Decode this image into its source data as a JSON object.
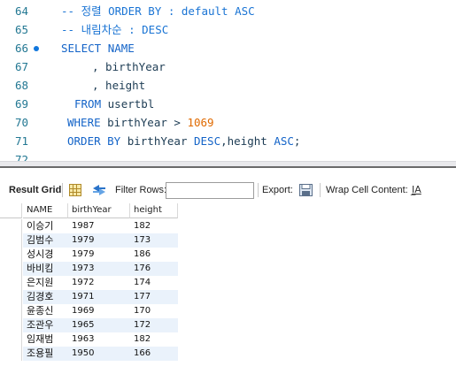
{
  "editor": {
    "lines": [
      {
        "no": "64",
        "indent": 0,
        "tokens": [
          {
            "t": "-- 정렬 ORDER BY : default ASC",
            "c": "comment"
          }
        ]
      },
      {
        "no": "65",
        "indent": 0,
        "tokens": [
          {
            "t": "-- 내림차순 : DESC",
            "c": "comment"
          }
        ]
      },
      {
        "no": "66",
        "indent": 0,
        "breakpoint": true,
        "tokens": [
          {
            "t": "SELECT ",
            "c": "kw"
          },
          {
            "t": "NAME",
            "c": "kw"
          }
        ]
      },
      {
        "no": "67",
        "indent": 1,
        "tokens": [
          {
            "t": ", birthYear",
            "c": "id"
          }
        ]
      },
      {
        "no": "68",
        "indent": 1,
        "tokens": [
          {
            "t": ", height",
            "c": "id"
          }
        ]
      },
      {
        "no": "69",
        "indent": 2,
        "tokens": [
          {
            "t": "FROM ",
            "c": "kw"
          },
          {
            "t": "usertbl",
            "c": "id"
          }
        ]
      },
      {
        "no": "70",
        "indent": 3,
        "tokens": [
          {
            "t": "WHERE ",
            "c": "kw"
          },
          {
            "t": "birthYear > ",
            "c": "id"
          },
          {
            "t": "1069",
            "c": "num"
          }
        ]
      },
      {
        "no": "71",
        "indent": 3,
        "tokens": [
          {
            "t": "ORDER BY ",
            "c": "kw"
          },
          {
            "t": "birthYear ",
            "c": "id"
          },
          {
            "t": "DESC",
            "c": "kw"
          },
          {
            "t": ",height ",
            "c": "id"
          },
          {
            "t": "ASC",
            "c": "kw"
          },
          {
            "t": ";",
            "c": "id"
          }
        ]
      },
      {
        "no": "72",
        "indent": 0,
        "tokens": []
      }
    ]
  },
  "toolbar": {
    "result_grid_label": "Result Grid",
    "filter_rows_label": "Filter Rows:",
    "filter_rows_value": "",
    "export_label": "Export:",
    "wrap_cell_label": "Wrap Cell Content:",
    "wrap_icon": "wrap-text-icon"
  },
  "grid": {
    "columns": [
      "NAME",
      "birthYear",
      "height"
    ],
    "rows": [
      [
        "이승기",
        "1987",
        "182"
      ],
      [
        "김범수",
        "1979",
        "173"
      ],
      [
        "성시경",
        "1979",
        "186"
      ],
      [
        "바비킴",
        "1973",
        "176"
      ],
      [
        "은지원",
        "1972",
        "174"
      ],
      [
        "김경호",
        "1971",
        "177"
      ],
      [
        "윤종신",
        "1969",
        "170"
      ],
      [
        "조관우",
        "1965",
        "172"
      ],
      [
        "임재범",
        "1963",
        "182"
      ],
      [
        "조용필",
        "1950",
        "166"
      ]
    ]
  },
  "colors": {
    "comment": "#1a74d4",
    "keyword": "#1464c8",
    "identifier": "#1d3c54",
    "number": "#e06a00",
    "alt_row": "#eaf2fb"
  }
}
